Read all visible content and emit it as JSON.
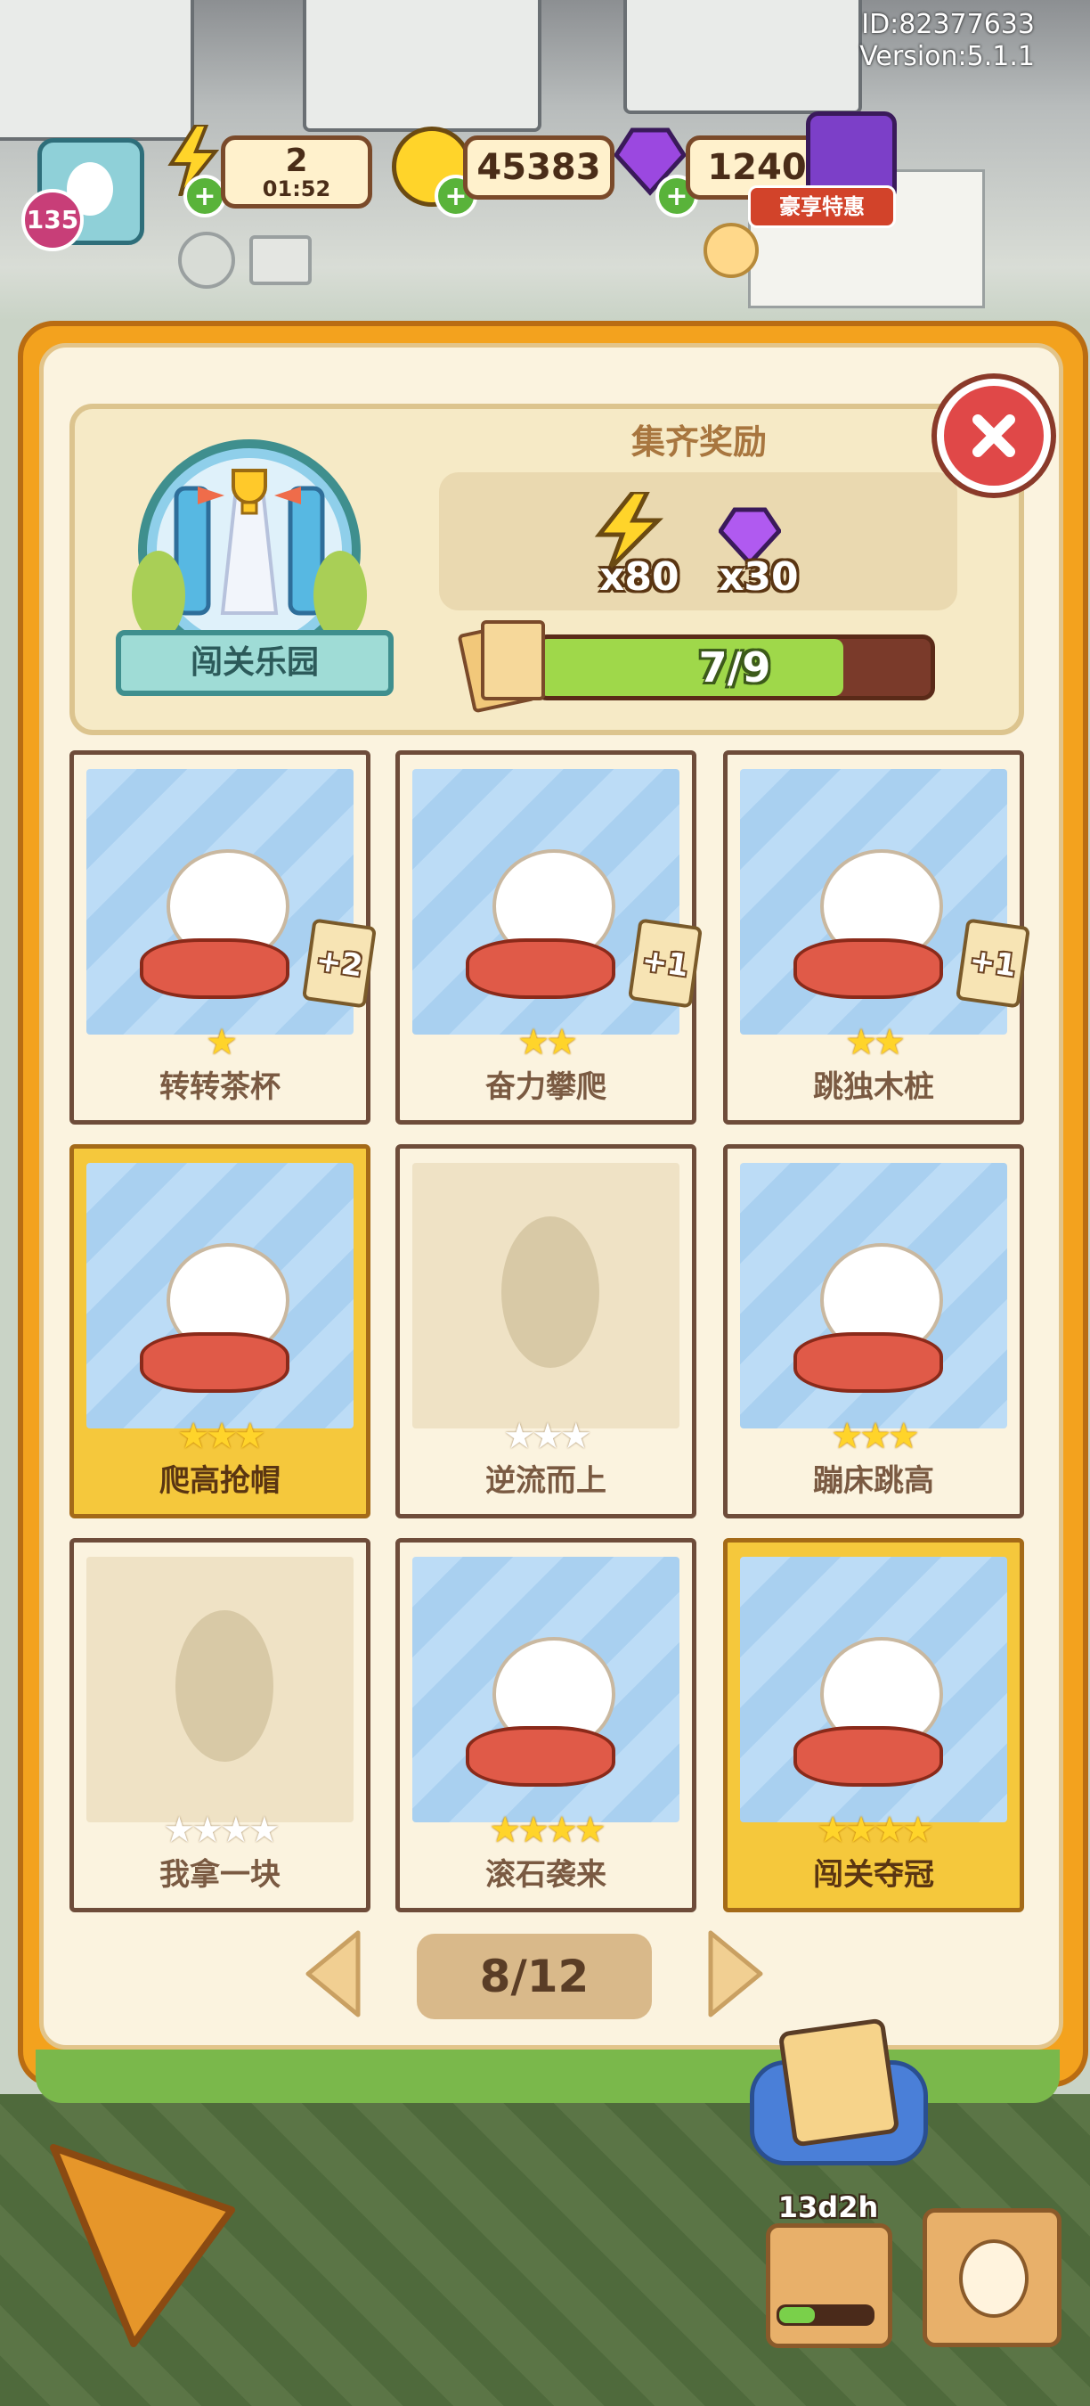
{
  "hud": {
    "account_id": "ID:82377633",
    "version": "Version:5.1.1",
    "level": "135",
    "energy": "2",
    "energy_timer": "01:52",
    "coins": "45383",
    "gems": "1240",
    "promo_tag": "豪享特惠"
  },
  "reward": {
    "title": "集齐奖励",
    "energy_amount": "x80",
    "gem_amount": "x30",
    "progress_text": "7/9",
    "progress_fraction": 0.778
  },
  "album": {
    "badge_label": "闯关乐园"
  },
  "cards": [
    {
      "name": "转转茶杯",
      "stars_total": 1,
      "stars_on": 1,
      "extra": "+2",
      "owned": true,
      "gold": false
    },
    {
      "name": "奋力攀爬",
      "stars_total": 2,
      "stars_on": 2,
      "extra": "+1",
      "owned": true,
      "gold": false
    },
    {
      "name": "跳独木桩",
      "stars_total": 2,
      "stars_on": 2,
      "extra": "+1",
      "owned": true,
      "gold": false
    },
    {
      "name": "爬高抢帽",
      "stars_total": 3,
      "stars_on": 3,
      "extra": "",
      "owned": true,
      "gold": true
    },
    {
      "name": "逆流而上",
      "stars_total": 3,
      "stars_on": 0,
      "extra": "",
      "owned": false,
      "gold": false
    },
    {
      "name": "蹦床跳高",
      "stars_total": 3,
      "stars_on": 3,
      "extra": "",
      "owned": true,
      "gold": false
    },
    {
      "name": "我拿一块",
      "stars_total": 4,
      "stars_on": 0,
      "extra": "",
      "owned": false,
      "gold": false
    },
    {
      "name": "滚石袭来",
      "stars_total": 4,
      "stars_on": 4,
      "extra": "",
      "owned": true,
      "gold": false
    },
    {
      "name": "闯关夺冠",
      "stars_total": 4,
      "stars_on": 4,
      "extra": "",
      "owned": true,
      "gold": true
    }
  ],
  "pager": {
    "page_text": "8/12"
  },
  "bottom": {
    "event_timer": "13d2h"
  },
  "colors": {
    "panel_orange": "#f3a21e",
    "progress_green": "#9fd84a",
    "close_red": "#e04848",
    "gold_card": "#f5c83c"
  }
}
